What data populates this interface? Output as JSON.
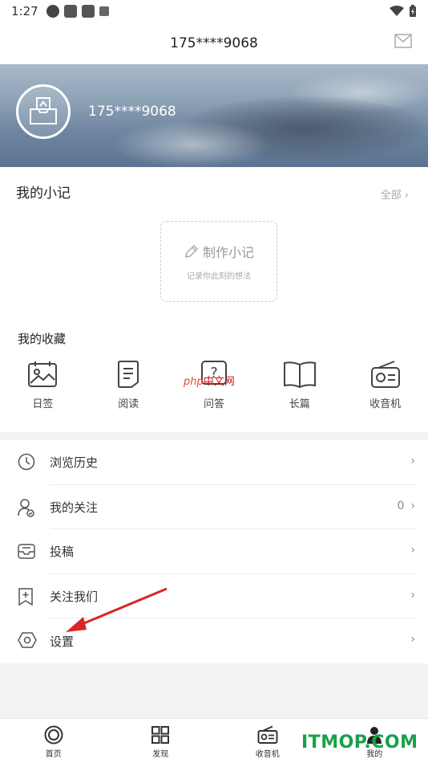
{
  "status_bar": {
    "time": "1:27"
  },
  "header": {
    "title": "175****9068"
  },
  "profile": {
    "username": "175****9068"
  },
  "notes": {
    "title": "我的小记",
    "all_label": "全部",
    "make_note_label": "制作小记",
    "make_note_hint": "记录你此刻的想法"
  },
  "favorites": {
    "title": "我的收藏",
    "items": [
      {
        "label": "日签",
        "icon": "calendar-image-icon"
      },
      {
        "label": "阅读",
        "icon": "document-icon"
      },
      {
        "label": "问答",
        "icon": "question-icon"
      },
      {
        "label": "长篇",
        "icon": "open-book-icon"
      },
      {
        "label": "收音机",
        "icon": "radio-icon"
      }
    ]
  },
  "watermark": {
    "prefix": "php",
    "text": "中文网"
  },
  "menu": {
    "items": [
      {
        "label": "浏览历史",
        "icon": "clock-icon",
        "value": ""
      },
      {
        "label": "我的关注",
        "icon": "user-follow-icon",
        "value": "0"
      },
      {
        "label": "投稿",
        "icon": "inbox-icon",
        "value": ""
      },
      {
        "label": "关注我们",
        "icon": "bookmark-plus-icon",
        "value": ""
      },
      {
        "label": "设置",
        "icon": "settings-hexagon-icon",
        "value": ""
      }
    ]
  },
  "tabs": [
    {
      "label": "首页",
      "icon": "home-circle-icon"
    },
    {
      "label": "发现",
      "icon": "grid-icon"
    },
    {
      "label": "收音机",
      "icon": "radio-icon"
    },
    {
      "label": "我的",
      "icon": "person-icon"
    }
  ],
  "brand_watermark": "ITMOP.COM",
  "colors": {
    "accent_green": "#1aa04a",
    "annotation_red": "#d92626"
  }
}
